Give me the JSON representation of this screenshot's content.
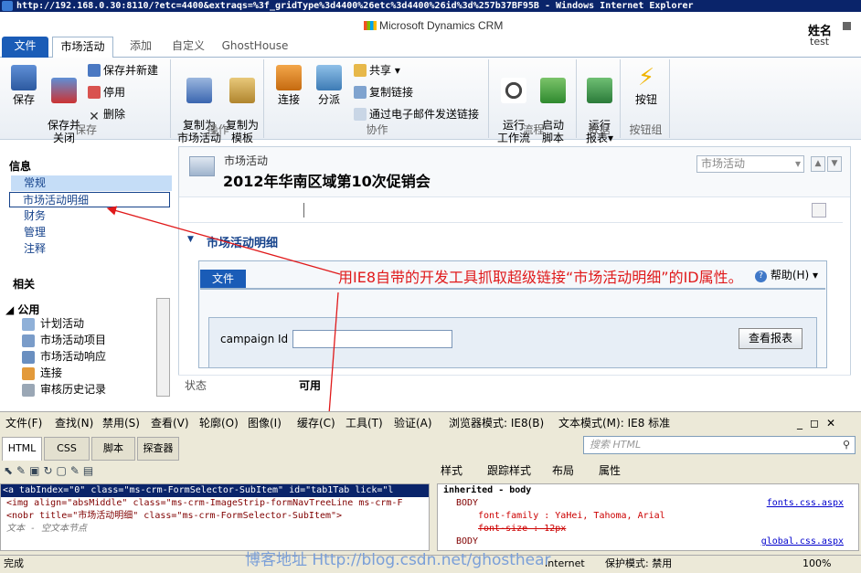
{
  "window_title": "http://192.168.0.30:8110/?etc=4400&extraqs=%3f_gridType%3d4400%26etc%3d4400%26id%3d%257b37BF95B - Windows Internet Explorer",
  "logo_text": "Microsoft Dynamics CRM",
  "user": {
    "name": "姓名",
    "org": "test"
  },
  "tabs": {
    "file": "文件",
    "campaign": "市场活动",
    "add": "添加",
    "custom": "自定义",
    "ghost": "GhostHouse"
  },
  "ribbon": {
    "save": {
      "save": "保存",
      "save_close": "保存并\n关闭",
      "save_new": "保存并新建",
      "deactivate": "停用",
      "delete": "删除",
      "label": "保存"
    },
    "actions": {
      "copy_campaign": "复制为\n市场活动",
      "copy_template": "复制为\n模板",
      "label": "操作"
    },
    "collab": {
      "connect": "连接",
      "assign": "分派",
      "share": "共享",
      "copy_link": "复制链接",
      "email_link": "通过电子邮件发送链接",
      "label": "协作"
    },
    "process": {
      "run_workflow": "运行\n工作流",
      "start_dialog": "启动\n脚本",
      "label": "流程"
    },
    "data": {
      "run_report": "运行\n报表",
      "label": "数据"
    },
    "buttons": {
      "button": "按钮",
      "label": "按钮组"
    }
  },
  "leftnav": {
    "info_head": "信息",
    "items": [
      "常规",
      "市场活动明细",
      "财务",
      "管理",
      "注释"
    ],
    "related_head": "相关",
    "common_head": "公用",
    "related_items": [
      "计划活动",
      "市场活动项目",
      "市场活动响应",
      "连接",
      "审核历史记录"
    ]
  },
  "form": {
    "entity": "市场活动",
    "title": "2012年华南区域第10次促销会",
    "selector": "市场活动",
    "section": "市场活动明细",
    "sub_file": "文件",
    "help": "帮助(H)",
    "campaign_id_label": "campaign Id",
    "view_report": "查看报表",
    "status_label": "状态",
    "status_value": "可用"
  },
  "annotation": "用IE8自带的开发工具抓取超级链接“市场活动明细”的ID属性。",
  "devtools": {
    "menu": [
      "文件(F)",
      "查找(N)",
      "禁用(S)",
      "查看(V)",
      "轮廓(O)",
      "图像(I)",
      "缓存(C)",
      "工具(T)",
      "验证(A)",
      "浏览器模式: IE8(B)",
      "文本模式(M): IE8 标准"
    ],
    "tabs": [
      "HTML",
      "CSS",
      "脚本",
      "探查器"
    ],
    "search_placeholder": "搜索 HTML",
    "style_tabs": [
      "样式",
      "跟踪样式",
      "布局",
      "属性"
    ],
    "tree": [
      "<a tabIndex=\"0\" class=\"ms-crm-FormSelector-SubItem\" id=\"tab1Tab        lick=\"l",
      "  <img align=\"absMiddle\" class=\"ms-crm-ImageStrip-formNavTreeLine ms-crm-F",
      "  <nobr title=\"市场活动明细\" class=\"ms-crm-FormSelector-SubItem\">",
      "    文本 - 空文本节点"
    ],
    "styles": [
      {
        "text": "inherited - body",
        "link": ""
      },
      {
        "text": "BODY",
        "link": "fonts.css.aspx"
      },
      {
        "text": "font-family : YaHei, Tahoma, Arial",
        "link": ""
      },
      {
        "text": "font-size : 12px",
        "link": ""
      },
      {
        "text": "BODY",
        "link": "global.css.aspx"
      }
    ]
  },
  "statusbar": {
    "left": "完成",
    "zone": "Internet",
    "protected": "保护模式: 禁用",
    "zoom": "100%"
  },
  "blog_watermark": "博客地址 Http://blog.csdn.net/ghosthear"
}
